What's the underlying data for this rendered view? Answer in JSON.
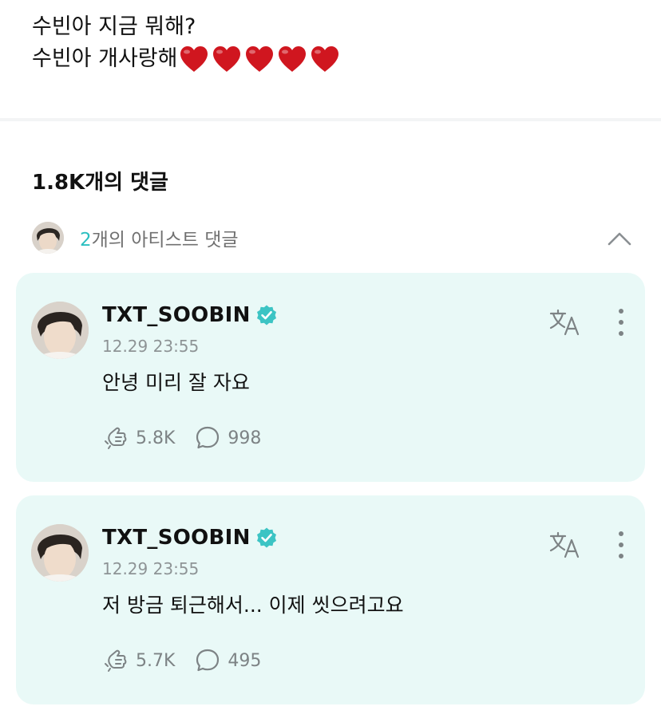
{
  "post": {
    "line1": "수빈아 지금 뭐해?",
    "line2": "수빈아 개사랑해",
    "heart_count": 5,
    "heart_color": "#d0161f"
  },
  "comments_title": "1.8K개의 댓글",
  "artist_comments": {
    "count": "2",
    "label": "개의 아티스트 댓글",
    "accent": "#2bbfc0"
  },
  "comments": [
    {
      "author": "TXT_SOOBIN",
      "verified": true,
      "time": "12.29 23:55",
      "text": "안녕 미리 잘 자요",
      "likes": "5.8K",
      "replies": "998"
    },
    {
      "author": "TXT_SOOBIN",
      "verified": true,
      "time": "12.29 23:55",
      "text": "저 방금 퇴근해서... 이제 씻으려고요",
      "likes": "5.7K",
      "replies": "495"
    }
  ],
  "icons": {
    "verified": "verified-badge-icon",
    "translate": "translate-icon",
    "more": "more-vertical-icon",
    "like": "like-hand-icon",
    "reply": "speech-bubble-icon",
    "collapse": "chevron-up-icon"
  },
  "colors": {
    "card_background": "#e9f9f7",
    "verified": "#3cc4c4",
    "muted_text": "#8e9496"
  }
}
